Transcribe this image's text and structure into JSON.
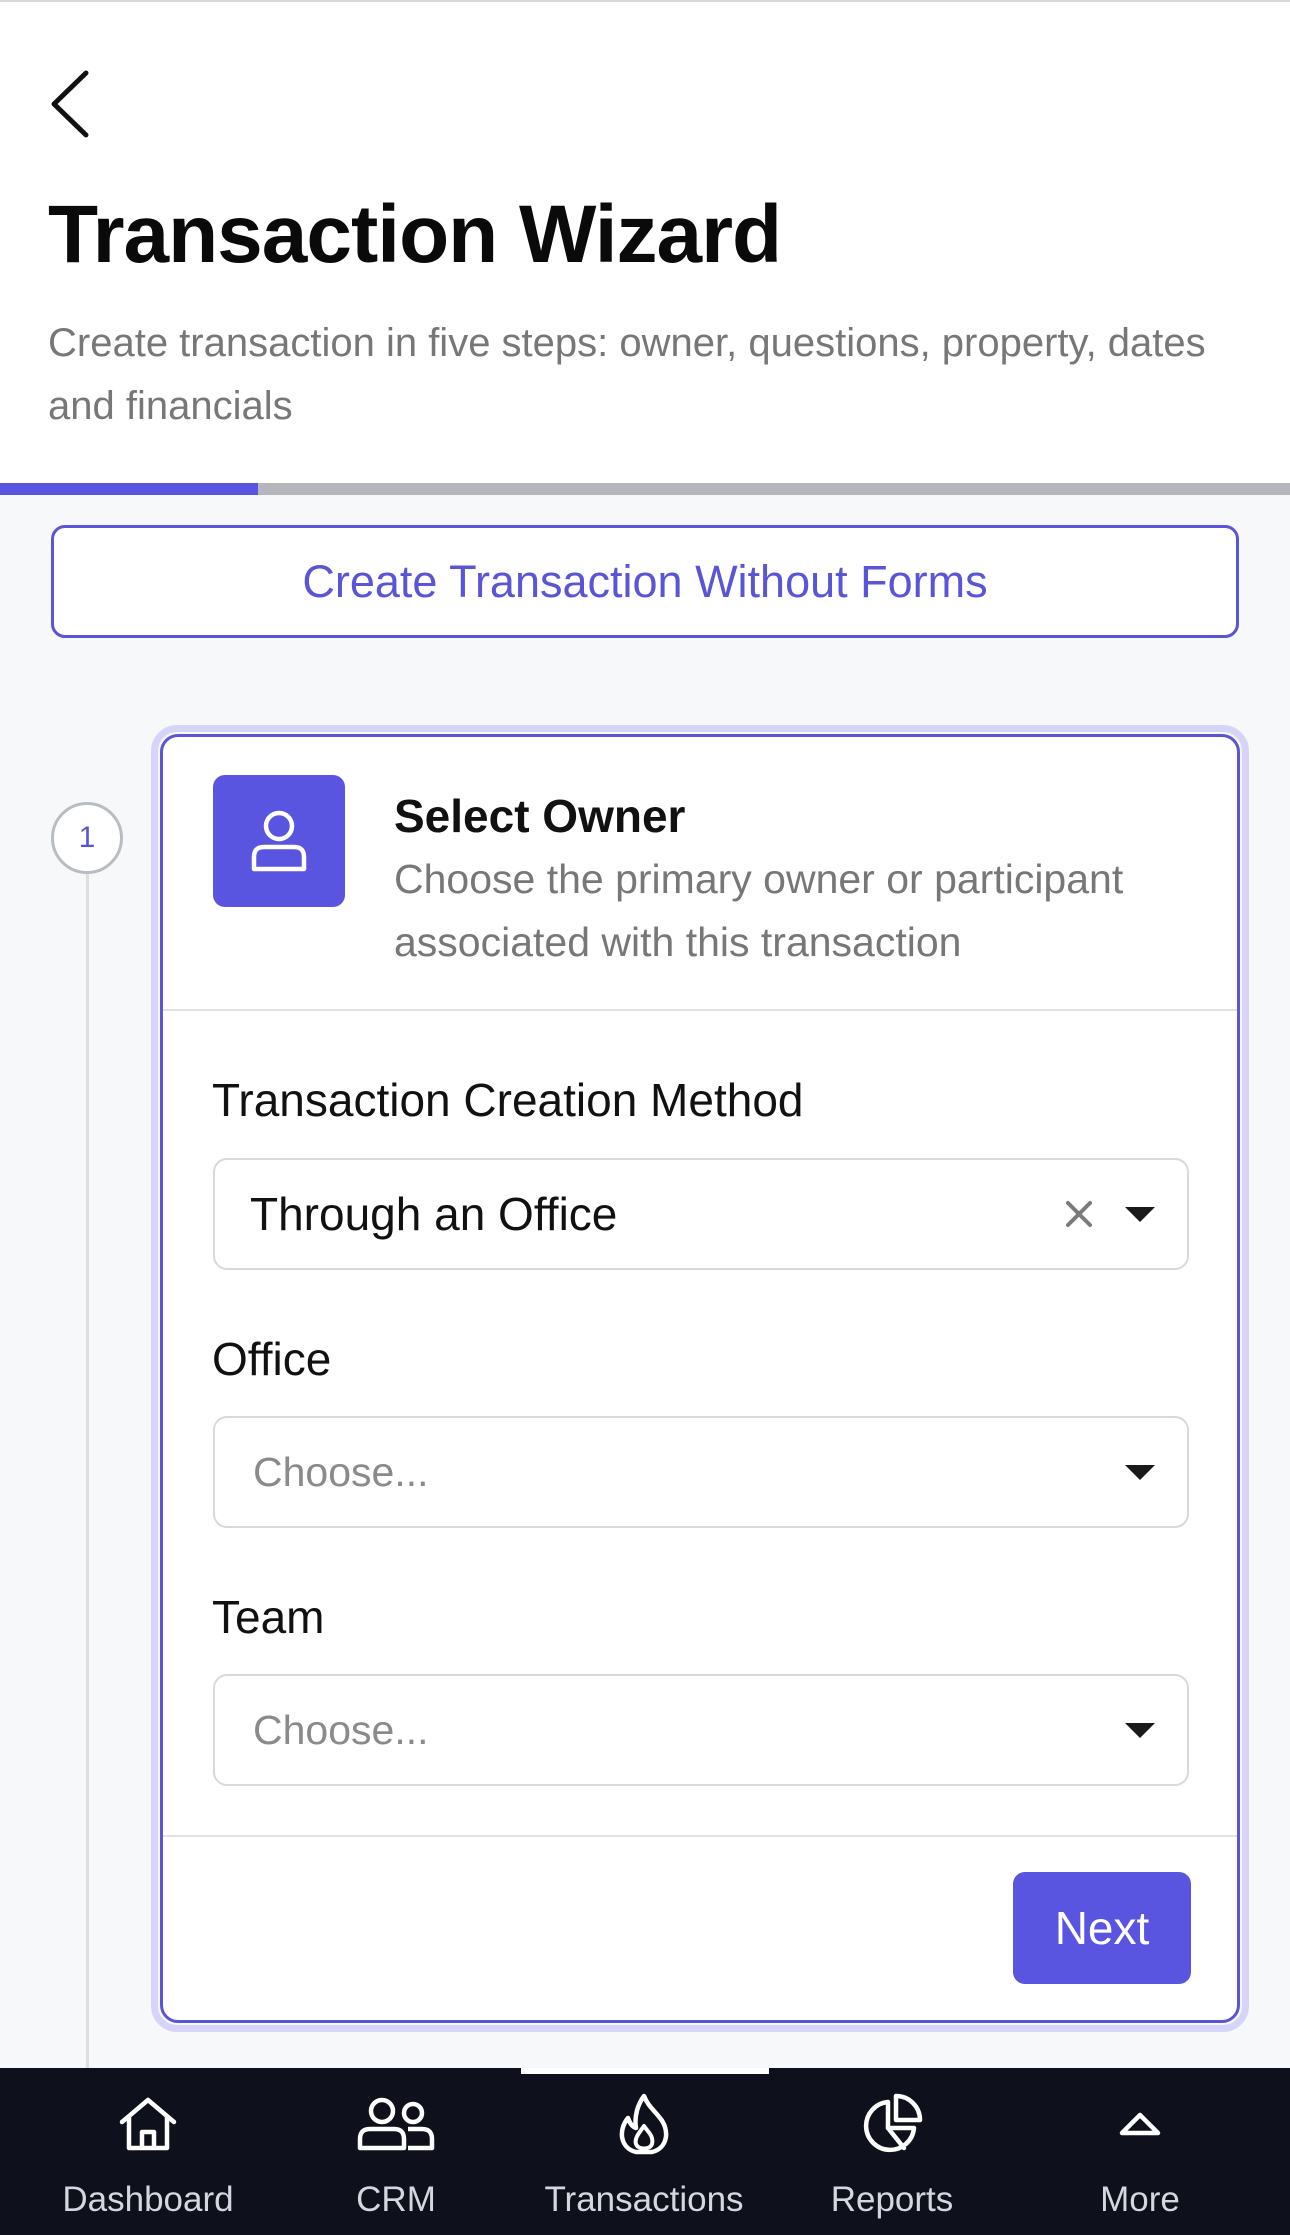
{
  "header": {
    "title": "Transaction Wizard",
    "subtitle": "Create transaction in five steps: owner, questions, property, dates and financials"
  },
  "progress": {
    "fraction": 0.2
  },
  "actions": {
    "no_forms_label": "Create Transaction Without Forms"
  },
  "step": {
    "number": "1",
    "title": "Select Owner",
    "description": "Choose the primary owner or participant associated with this transaction",
    "icon": "user-icon"
  },
  "form": {
    "method": {
      "label": "Transaction Creation Method",
      "value": "Through an Office"
    },
    "office": {
      "label": "Office",
      "placeholder": "Choose..."
    },
    "team": {
      "label": "Team",
      "placeholder": "Choose..."
    },
    "next_label": "Next"
  },
  "nav": {
    "items": [
      {
        "label": "Dashboard",
        "icon": "home-icon"
      },
      {
        "label": "CRM",
        "icon": "users-icon"
      },
      {
        "label": "Transactions",
        "icon": "flame-icon"
      },
      {
        "label": "Reports",
        "icon": "pie-chart-icon"
      },
      {
        "label": "More",
        "icon": "chevron-up-icon"
      }
    ]
  },
  "colors": {
    "accent": "#5a55e0",
    "nav_background": "#0e111b",
    "muted_text": "#777777"
  }
}
